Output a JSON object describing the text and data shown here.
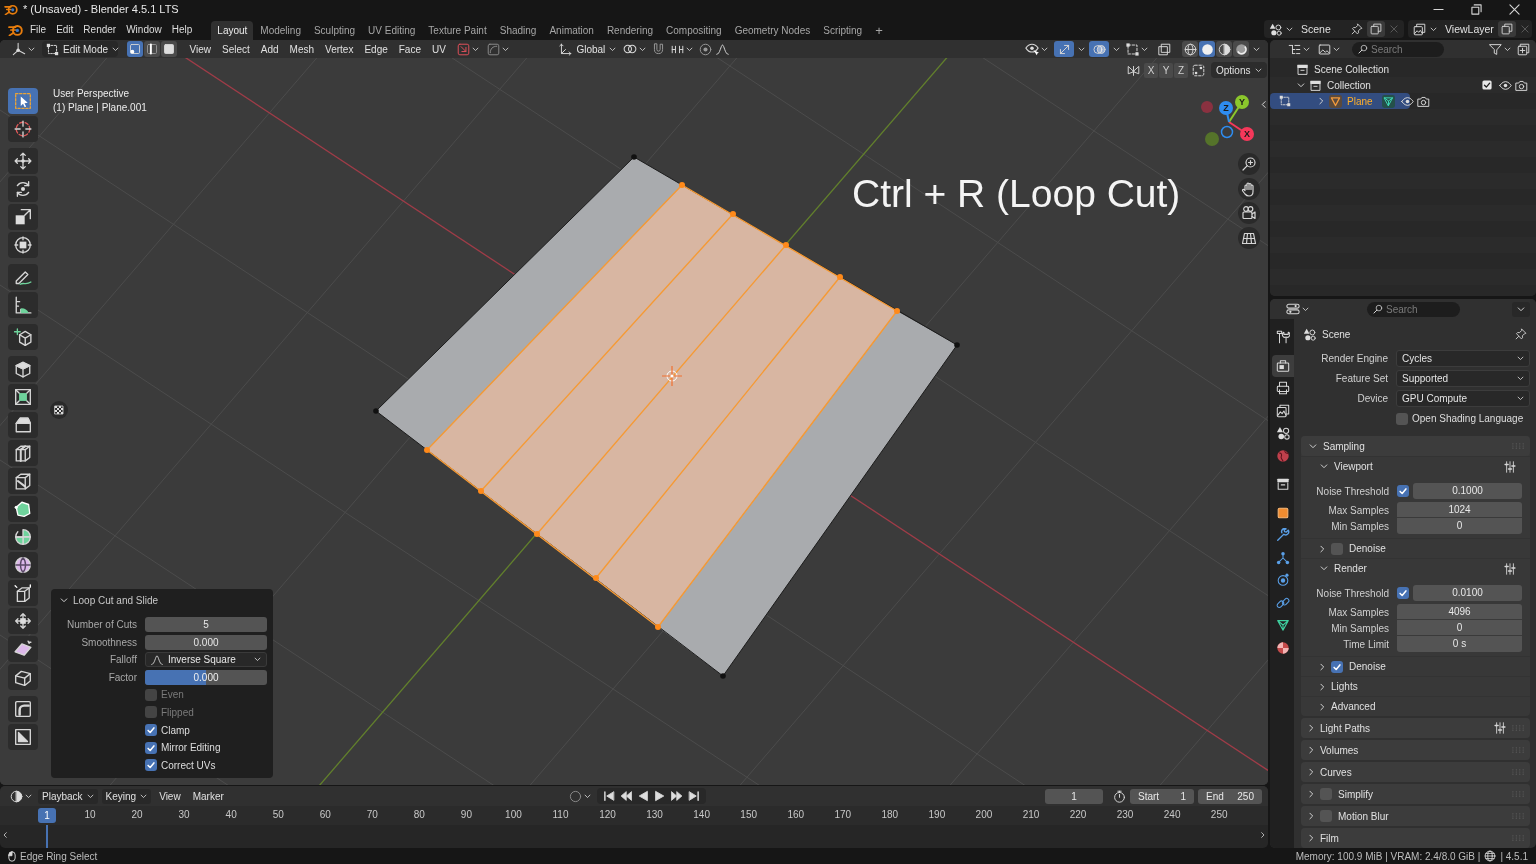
{
  "window": {
    "title": "* (Unsaved) - Blender 4.5.1 LTS"
  },
  "top_bar": {
    "menus": [
      "File",
      "Edit",
      "Render",
      "Window",
      "Help"
    ],
    "workspaces": [
      {
        "label": "Layout",
        "selected": true
      },
      {
        "label": "Modeling",
        "selected": false
      },
      {
        "label": "Sculpting",
        "selected": false
      },
      {
        "label": "UV Editing",
        "selected": false
      },
      {
        "label": "Texture Paint",
        "selected": false
      },
      {
        "label": "Shading",
        "selected": false
      },
      {
        "label": "Animation",
        "selected": false
      },
      {
        "label": "Rendering",
        "selected": false
      },
      {
        "label": "Compositing",
        "selected": false
      },
      {
        "label": "Geometry Nodes",
        "selected": false
      },
      {
        "label": "Scripting",
        "selected": false
      }
    ],
    "add_workspace": "+",
    "scene": "Scene",
    "view_layer": "ViewLayer"
  },
  "viewport": {
    "header": {
      "mode": "Edit Mode",
      "select_modes": [
        {
          "kind": "vertex",
          "selected": true
        },
        {
          "kind": "edge",
          "selected": false
        },
        {
          "kind": "face",
          "selected": false
        }
      ],
      "menus": [
        "View",
        "Select",
        "Add",
        "Mesh",
        "Vertex",
        "Edge",
        "Face",
        "UV"
      ],
      "orientation": "Global",
      "toggles": [
        {
          "kind": "gizmos",
          "on": true
        },
        {
          "kind": "overlays",
          "on": true
        },
        {
          "kind": "xray",
          "on": false
        }
      ],
      "shading_modes": [
        {
          "kind": "wireframe",
          "selected": false
        },
        {
          "kind": "solid",
          "selected": true
        },
        {
          "kind": "material",
          "selected": false
        },
        {
          "kind": "rendered",
          "selected": false
        }
      ]
    },
    "view_name": "User Perspective",
    "object_info": "(1) Plane | Plane.001",
    "mirror_axes": [
      "X",
      "Y",
      "Z"
    ],
    "options": "Options",
    "gizmo_axes": [
      {
        "label": "X",
        "color": "#f5385a"
      },
      {
        "label": "Y",
        "color": "#8bc72c"
      },
      {
        "label": "Z",
        "color": "#2e8cf0"
      }
    ],
    "annotation": "Ctrl + R (Loop Cut)",
    "toolbar": [
      [
        {
          "selected": true
        },
        {
          "selected": false
        }
      ],
      [
        {
          "selected": false
        },
        {
          "selected": false
        },
        {
          "selected": false
        },
        {
          "selected": false
        }
      ],
      [
        {
          "selected": false
        },
        {
          "selected": false
        }
      ],
      [
        {
          "selected": false
        }
      ],
      [
        {
          "selected": false
        },
        {
          "selected": false
        },
        {
          "selected": false
        },
        {
          "selected": false
        },
        {
          "selected": false
        },
        {
          "selected": false
        },
        {
          "selected": false
        },
        {
          "selected": false
        },
        {
          "selected": false
        },
        {
          "selected": false
        },
        {
          "selected": false
        },
        {
          "selected": false
        }
      ],
      [
        {
          "selected": false
        },
        {
          "selected": false
        }
      ]
    ],
    "operator_panel": {
      "title": "Loop Cut and Slide",
      "expanded": true,
      "rows": [
        {
          "kind": "number",
          "label": "Number of Cuts",
          "value": "5"
        },
        {
          "kind": "number",
          "label": "Smoothness",
          "value": "0.000"
        },
        {
          "kind": "dropdown",
          "label": "Falloff",
          "value": "Inverse Square"
        },
        {
          "kind": "slider",
          "label": "Factor",
          "value": "0.000",
          "level": 0.5
        },
        {
          "kind": "checkbox",
          "label": "Even",
          "checked": false,
          "disabled": true
        },
        {
          "kind": "checkbox",
          "label": "Flipped",
          "checked": false,
          "disabled": true
        },
        {
          "kind": "checkbox",
          "label": "Clamp",
          "checked": true,
          "disabled": false
        },
        {
          "kind": "checkbox",
          "label": "Mirror Editing",
          "checked": true,
          "disabled": false
        },
        {
          "kind": "checkbox",
          "label": "Correct UVs",
          "checked": true,
          "disabled": false
        }
      ]
    }
  },
  "outliner": {
    "search": {
      "placeholder": "Search"
    },
    "tree": [
      {
        "kind": "scene_collection",
        "label": "Scene Collection",
        "selected": false,
        "children": [
          {
            "kind": "collection",
            "label": "Collection",
            "expanded": true,
            "selected": false,
            "checked": true,
            "children": [
              {
                "kind": "object",
                "label": "Plane",
                "expanded": false,
                "selected": true
              }
            ]
          }
        ]
      }
    ]
  },
  "properties": {
    "search": {
      "placeholder": "Search"
    },
    "tabs": [
      {
        "selected": false
      },
      {
        "selected": true
      },
      {
        "selected": false
      },
      {
        "selected": false
      },
      {
        "selected": false
      },
      {
        "selected": false
      },
      {
        "selected": false
      },
      {
        "selected": false
      },
      {
        "selected": false
      },
      {
        "selected": false
      },
      {
        "selected": false
      },
      {
        "selected": false
      },
      {
        "selected": false
      },
      {
        "selected": false
      }
    ],
    "context": "Scene",
    "fields": [
      {
        "label": "Render Engine",
        "value": "Cycles"
      },
      {
        "label": "Feature Set",
        "value": "Supported"
      },
      {
        "label": "Device",
        "value": "GPU Compute"
      }
    ],
    "osl": {
      "label": "Open Shading Language",
      "checked": false
    },
    "panels": [
      {
        "label": "Sampling",
        "expanded": true,
        "subpanels": [
          {
            "label": "Viewport",
            "expanded": true,
            "presets": true,
            "rows": [
              {
                "kind": "toggle_number",
                "label": "Noise Threshold",
                "checked": true,
                "value": "0.1000"
              },
              {
                "kind": "number",
                "label": "Max Samples",
                "value": "1024"
              },
              {
                "kind": "number",
                "label": "Min Samples",
                "value": "0"
              }
            ]
          },
          {
            "label": "Denoise",
            "expanded": false,
            "checked": false
          },
          {
            "label": "Render",
            "expanded": true,
            "presets": true,
            "rows": [
              {
                "kind": "toggle_number",
                "label": "Noise Threshold",
                "checked": true,
                "value": "0.0100"
              },
              {
                "kind": "number",
                "label": "Max Samples",
                "value": "4096"
              },
              {
                "kind": "number",
                "label": "Min Samples",
                "value": "0"
              },
              {
                "kind": "number",
                "label": "Time Limit",
                "value": "0 s"
              }
            ]
          },
          {
            "label": "Denoise",
            "expanded": false,
            "checked": true
          },
          {
            "label": "Lights",
            "expanded": false
          },
          {
            "label": "Advanced",
            "expanded": false
          }
        ]
      },
      {
        "label": "Light Paths",
        "expanded": false,
        "presets": true
      },
      {
        "label": "Volumes",
        "expanded": false
      },
      {
        "label": "Curves",
        "expanded": false
      },
      {
        "label": "Simplify",
        "expanded": false,
        "checked": false
      },
      {
        "label": "Motion Blur",
        "expanded": false,
        "checked": false
      },
      {
        "label": "Film",
        "expanded": false
      }
    ]
  },
  "timeline": {
    "menus": [
      {
        "kind": "dropdown",
        "label": "Playback"
      },
      {
        "kind": "dropdown",
        "label": "Keying"
      },
      {
        "kind": "menu",
        "label": "View"
      },
      {
        "kind": "menu",
        "label": "Marker"
      }
    ],
    "current_frame": "1",
    "start": {
      "label": "Start",
      "value": "1"
    },
    "end": {
      "label": "End",
      "value": "250"
    },
    "playhead": "1",
    "ruler": [
      "10",
      "20",
      "30",
      "40",
      "50",
      "60",
      "70",
      "80",
      "90",
      "100",
      "110",
      "120",
      "130",
      "140",
      "150",
      "160",
      "170",
      "180",
      "190",
      "200",
      "210",
      "220",
      "230",
      "240",
      "250"
    ]
  },
  "status_bar": {
    "hint": "Edge Ring Select",
    "stats": "Memory: 100.9 MiB | VRAM: 2.4/8.0 GiB |",
    "version": "| 4.5.1"
  }
}
